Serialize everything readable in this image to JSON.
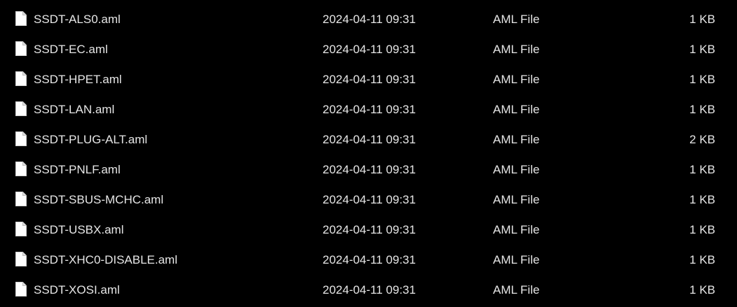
{
  "file_list": {
    "rows": [
      {
        "name": "SSDT-ALS0.aml",
        "modified": "2024-04-11 09:31",
        "type": "AML File",
        "size": "1 KB",
        "icon": "file-icon"
      },
      {
        "name": "SSDT-EC.aml",
        "modified": "2024-04-11 09:31",
        "type": "AML File",
        "size": "1 KB",
        "icon": "file-icon"
      },
      {
        "name": "SSDT-HPET.aml",
        "modified": "2024-04-11 09:31",
        "type": "AML File",
        "size": "1 KB",
        "icon": "file-icon"
      },
      {
        "name": "SSDT-LAN.aml",
        "modified": "2024-04-11 09:31",
        "type": "AML File",
        "size": "1 KB",
        "icon": "file-icon"
      },
      {
        "name": "SSDT-PLUG-ALT.aml",
        "modified": "2024-04-11 09:31",
        "type": "AML File",
        "size": "2 KB",
        "icon": "file-icon"
      },
      {
        "name": "SSDT-PNLF.aml",
        "modified": "2024-04-11 09:31",
        "type": "AML File",
        "size": "1 KB",
        "icon": "file-icon"
      },
      {
        "name": "SSDT-SBUS-MCHC.aml",
        "modified": "2024-04-11 09:31",
        "type": "AML File",
        "size": "1 KB",
        "icon": "file-icon"
      },
      {
        "name": "SSDT-USBX.aml",
        "modified": "2024-04-11 09:31",
        "type": "AML File",
        "size": "1 KB",
        "icon": "file-icon"
      },
      {
        "name": "SSDT-XHC0-DISABLE.aml",
        "modified": "2024-04-11 09:31",
        "type": "AML File",
        "size": "1 KB",
        "icon": "file-icon"
      },
      {
        "name": "SSDT-XOSI.aml",
        "modified": "2024-04-11 09:31",
        "type": "AML File",
        "size": "1 KB",
        "icon": "file-icon"
      }
    ]
  },
  "colors": {
    "background": "#000000",
    "text": "#e6e6e6",
    "icon_fill": "#ffffff"
  }
}
